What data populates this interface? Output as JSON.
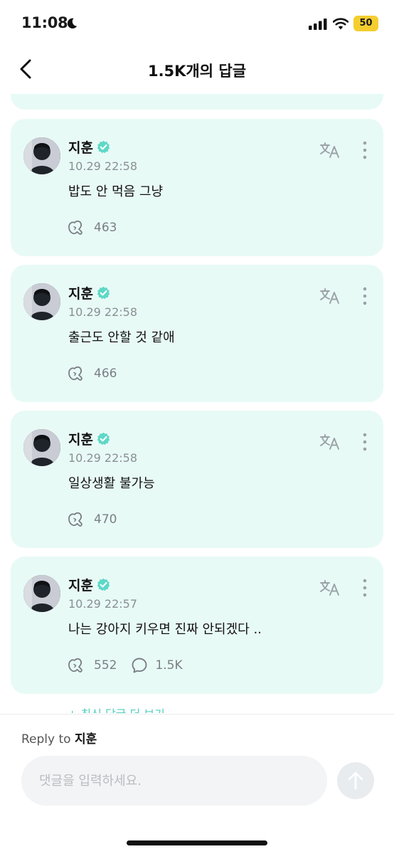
{
  "status_bar": {
    "time": "11:08",
    "battery": "50",
    "icons": [
      "moon-icon",
      "signal-icon",
      "wifi-icon",
      "battery-icon"
    ]
  },
  "header": {
    "title": "1.5K개의 답글",
    "back_icon": "chevron-left-icon"
  },
  "comments": [
    {
      "author": "지훈",
      "time": "10.29 22:58",
      "text": "밥도 안 먹음 그냥",
      "likes": "463",
      "replies": ""
    },
    {
      "author": "지훈",
      "time": "10.29 22:58",
      "text": "출근도 안할 것 같애",
      "likes": "466",
      "replies": ""
    },
    {
      "author": "지훈",
      "time": "10.29 22:58",
      "text": "일상생활 불가능",
      "likes": "470",
      "replies": ""
    },
    {
      "author": "지훈",
      "time": "10.29 22:57",
      "text": "나는 강아지 키우면 진짜 안되겠다 ..",
      "likes": "552",
      "replies": "1.5K"
    }
  ],
  "more_replies": "+ 최신 답글 더 보기",
  "reply": {
    "prefix": "Reply to",
    "target": "지훈",
    "placeholder": "댓글을 입력하세요."
  },
  "colors": {
    "card_bg": "#e8faf6",
    "accent": "#4fd0bd",
    "verified": "#5fd8c8",
    "battery": "#f5cd2f"
  }
}
